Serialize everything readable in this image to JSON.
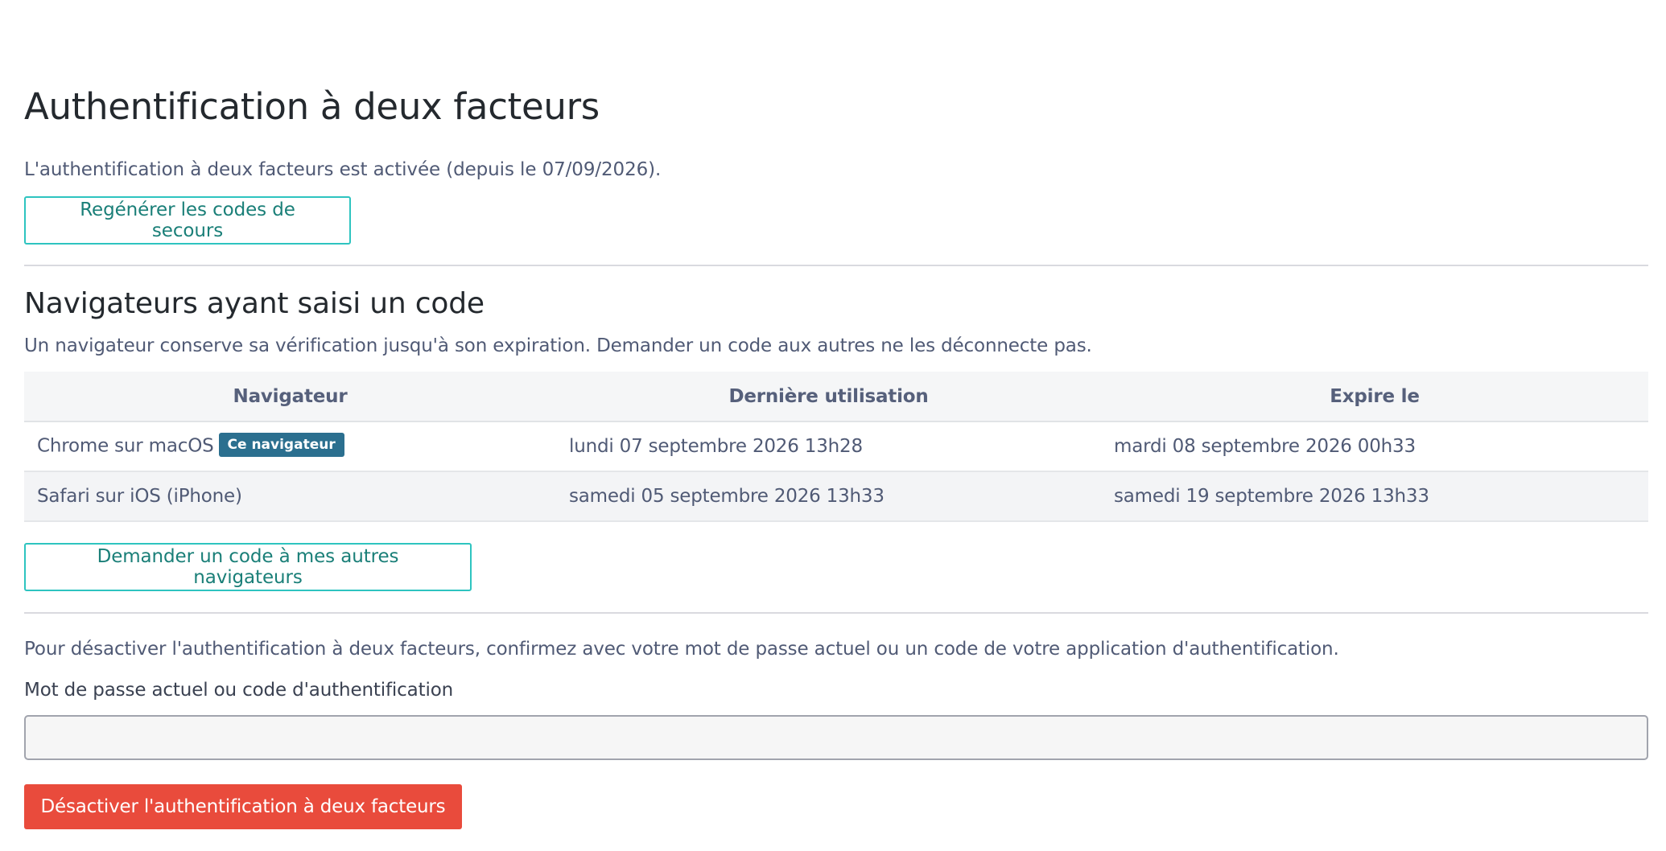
{
  "header": {
    "title": "Authentification à deux facteurs"
  },
  "status": {
    "text": "L'authentification à deux facteurs est activée (depuis le 07/09/2026)."
  },
  "actions": {
    "regenerate_label": "Regénérer les codes de secours",
    "request_code_label": "Demander un code à mes autres navigateurs"
  },
  "browsers": {
    "title": "Navigateurs ayant saisi un code",
    "help": "Un navigateur conserve sa vérification jusqu'à son expiration. Demander un code aux autres ne les déconnecte pas.",
    "columns": [
      "Navigateur",
      "Dernière utilisation",
      "Expire le"
    ],
    "rows": [
      {
        "browser": "Chrome sur macOS",
        "badge": "Ce navigateur",
        "last_used": "lundi 07 septembre 2026 13h28",
        "expires": "mardi 08 septembre 2026 00h33"
      },
      {
        "browser": "Safari sur iOS (iPhone)",
        "badge": "",
        "last_used": "samedi 05 septembre 2026 13h33",
        "expires": "samedi 19 septembre 2026 13h33"
      }
    ]
  },
  "deactivate": {
    "help": "Pour désactiver l'authentification à deux facteurs, confirmez avec votre mot de passe actuel ou un code de votre application d'authentification.",
    "field_label": "Mot de passe actuel ou code d'authentification",
    "field_value": "",
    "field_placeholder": "",
    "button_label": "Désactiver l'authentification à deux facteurs"
  },
  "colors": {
    "accent": "#2ec4c0",
    "accent_text": "#1a7f78",
    "badge": "#2b6f8f",
    "danger": "#e94b3c"
  }
}
